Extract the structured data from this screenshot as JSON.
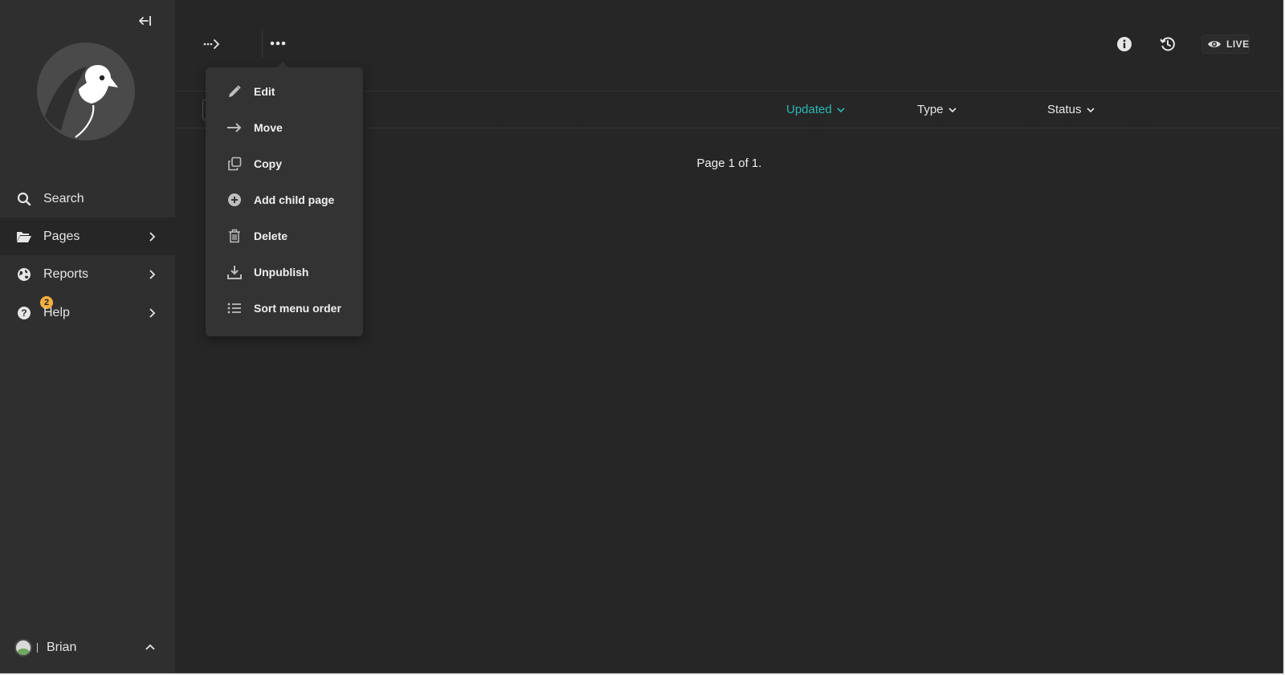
{
  "colors": {
    "sidebar_bg": "#2f2f2f",
    "main_bg": "#262626",
    "accent_teal": "#2bb6b6",
    "badge_yellow": "#f5b042",
    "text": "#e6e6e6"
  },
  "sidebar": {
    "collapse_icon": "arrow-left-to-line-icon",
    "logo_icon": "bird-logo-icon",
    "items": [
      {
        "label": "Search",
        "icon": "search-icon"
      },
      {
        "label": "Pages",
        "icon": "folder-open-icon",
        "active": true
      },
      {
        "label": "Reports",
        "icon": "globe-icon"
      },
      {
        "label": "Help",
        "icon": "help-circle-icon",
        "badge": "2"
      }
    ],
    "user": {
      "name": "Brian",
      "icon": "chevron-up-icon"
    }
  },
  "header": {
    "breadcrumb_icon": "dotted-arrow-right-icon",
    "more_icon": "more-dots-icon",
    "info_icon": "info-icon",
    "history_icon": "history-icon",
    "live_label": "LIVE"
  },
  "columns": {
    "updated": "Updated",
    "type": "Type",
    "status": "Status"
  },
  "pagination": {
    "text": "Page 1 of 1."
  },
  "menu": {
    "items": [
      {
        "label": "Edit",
        "icon": "pencil-icon"
      },
      {
        "label": "Move",
        "icon": "arrow-right-icon"
      },
      {
        "label": "Copy",
        "icon": "copy-icon"
      },
      {
        "label": "Add child page",
        "icon": "plus-circle-icon"
      },
      {
        "label": "Delete",
        "icon": "trash-icon"
      },
      {
        "label": "Unpublish",
        "icon": "download-icon"
      },
      {
        "label": "Sort menu order",
        "icon": "list-icon"
      }
    ]
  }
}
